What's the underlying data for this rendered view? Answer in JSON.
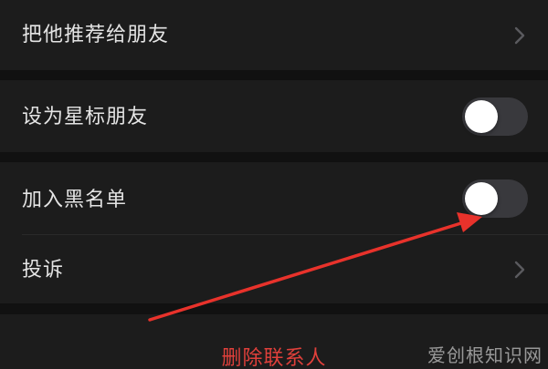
{
  "rows": [
    {
      "label": "把他推荐给朋友",
      "control": "chevron"
    },
    {
      "label": "设为星标朋友",
      "control": "toggle",
      "on": false
    },
    {
      "label": "加入黑名单",
      "control": "toggle",
      "on": false
    },
    {
      "label": "投诉",
      "control": "chevron"
    }
  ],
  "delete_action": {
    "label": "删除联系人",
    "color": "#e0403b"
  },
  "annotation": {
    "type": "arrow",
    "color": "#e8322b"
  },
  "watermark": {
    "text": "爱创根知识网"
  },
  "colors": {
    "background": "#111111",
    "cell": "#1c1c1c",
    "text": "#e4e4e4",
    "toggle_off": "#39393d",
    "chevron": "#5a5a5e"
  }
}
